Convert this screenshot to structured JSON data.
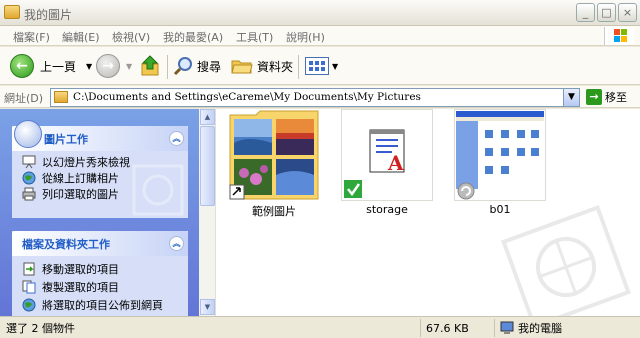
{
  "window": {
    "title": "我的圖片"
  },
  "menubar": {
    "items": [
      "檔案(F)",
      "編輯(E)",
      "檢視(V)",
      "我的最愛(A)",
      "工具(T)",
      "說明(H)"
    ]
  },
  "toolbar": {
    "back_label": "上一頁",
    "search_label": "搜尋",
    "folders_label": "資料夾"
  },
  "address": {
    "label": "網址(D)",
    "value": "C:\\Documents and Settings\\eCareme\\My Documents\\My Pictures",
    "go_label": "移至"
  },
  "tasks": {
    "picture_tasks": {
      "title": "圖片工作",
      "items": [
        "以幻燈片秀來檢視",
        "從線上訂購相片",
        "列印選取的圖片"
      ]
    },
    "file_tasks": {
      "title": "檔案及資料夾工作",
      "items": [
        "移動選取的項目",
        "複製選取的項目",
        "將選取的項目公佈到網頁"
      ]
    }
  },
  "files": [
    {
      "name": "範例圖片",
      "type": "folder-shortcut"
    },
    {
      "name": "storage",
      "type": "document"
    },
    {
      "name": "b01",
      "type": "screenshot"
    }
  ],
  "status": {
    "selection": "選了 2 個物件",
    "size": "67.6 KB",
    "location": "我的電腦"
  }
}
